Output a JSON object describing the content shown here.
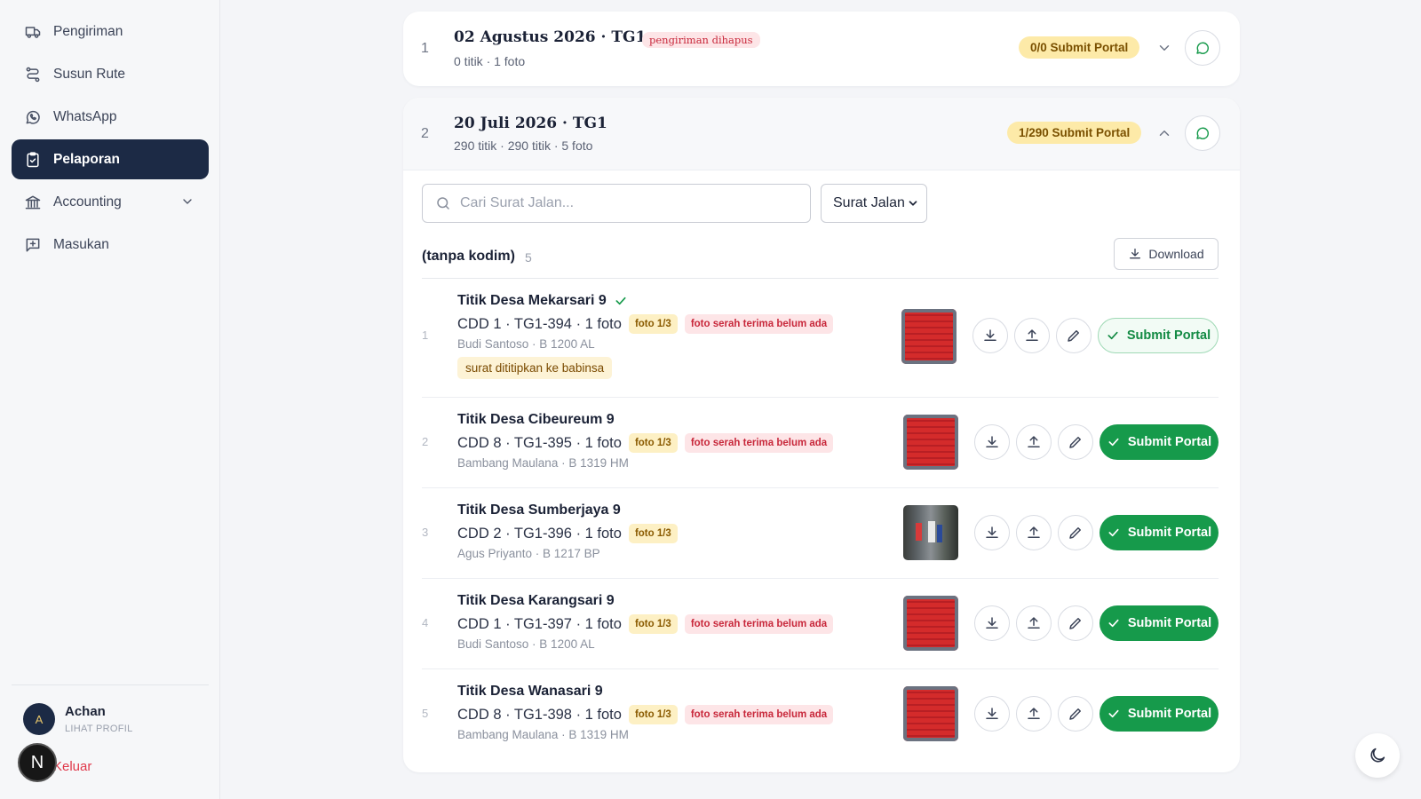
{
  "sidebar": {
    "items": [
      {
        "label": "Pengiriman",
        "icon": "truck-icon"
      },
      {
        "label": "Susun Rute",
        "icon": "route-icon"
      },
      {
        "label": "WhatsApp",
        "icon": "whatsapp-icon"
      },
      {
        "label": "Pelaporan",
        "icon": "clipboard-icon",
        "active": true
      },
      {
        "label": "Accounting",
        "icon": "bank-icon"
      },
      {
        "label": "Masukan",
        "icon": "feedback-icon"
      }
    ],
    "user": {
      "initial": "A",
      "name": "Achan",
      "profile_link": "LIHAT PROFIL"
    },
    "logout_label": "Keluar",
    "corner_badge": "N"
  },
  "shipments": [
    {
      "index": "1",
      "title": "02 Agustus 2026 · TG1",
      "status_pill": "pengiriman dihapus",
      "subtitle": "0 titik · 1 foto",
      "portal_badge": "0/0 Submit Portal"
    },
    {
      "index": "2",
      "title": "20 Juli 2026 · TG1",
      "subtitle": "290 titik · 290 titik · 5 foto",
      "portal_badge": "1/290 Submit Portal"
    }
  ],
  "filters": {
    "search_placeholder": "Cari Surat Jalan...",
    "select_value": "Surat Jalan"
  },
  "group": {
    "label": "(tanpa kodim)",
    "count": "5",
    "download_label": "Download"
  },
  "rows": [
    {
      "index": "1",
      "title": "Titik Desa Mekarsari 9",
      "code": "CDD 1 · TG1-394 · 1 foto",
      "photo_tag": "foto 1/3",
      "handover_tag": "foto serah terima belum ada",
      "driver": "Budi Santoso · B 1200 AL",
      "note": "surat dititipkan ke babinsa",
      "submit_label": "Submit Portal",
      "submitted": true
    },
    {
      "index": "2",
      "title": "Titik Desa Cibeureum 9",
      "code": "CDD 8 · TG1-395 · 1 foto",
      "photo_tag": "foto 1/3",
      "handover_tag": "foto serah terima belum ada",
      "driver": "Bambang Maulana · B 1319 HM",
      "submit_label": "Submit Portal",
      "submitted": false
    },
    {
      "index": "3",
      "title": "Titik Desa Sumberjaya 9",
      "code": "CDD 2 · TG1-396 · 1 foto",
      "photo_tag": "foto 1/3",
      "driver": "Agus Priyanto · B 1217 BP",
      "submit_label": "Submit Portal",
      "submitted": false
    },
    {
      "index": "4",
      "title": "Titik Desa Karangsari 9",
      "code": "CDD 1 · TG1-397 · 1 foto",
      "photo_tag": "foto 1/3",
      "handover_tag": "foto serah terima belum ada",
      "driver": "Budi Santoso · B 1200 AL",
      "submit_label": "Submit Portal",
      "submitted": false
    },
    {
      "index": "5",
      "title": "Titik Desa Wanasari 9",
      "code": "CDD 8 · TG1-398 · 1 foto",
      "photo_tag": "foto 1/3",
      "handover_tag": "foto serah terima belum ada",
      "driver": "Bambang Maulana · B 1319 HM",
      "submit_label": "Submit Portal",
      "submitted": false
    }
  ],
  "colors": {
    "sidebar_active": "#1c2a45",
    "submit_green": "#169a4b",
    "badge_yellow": "#fdeaa8",
    "danger_red": "#c8283b"
  }
}
